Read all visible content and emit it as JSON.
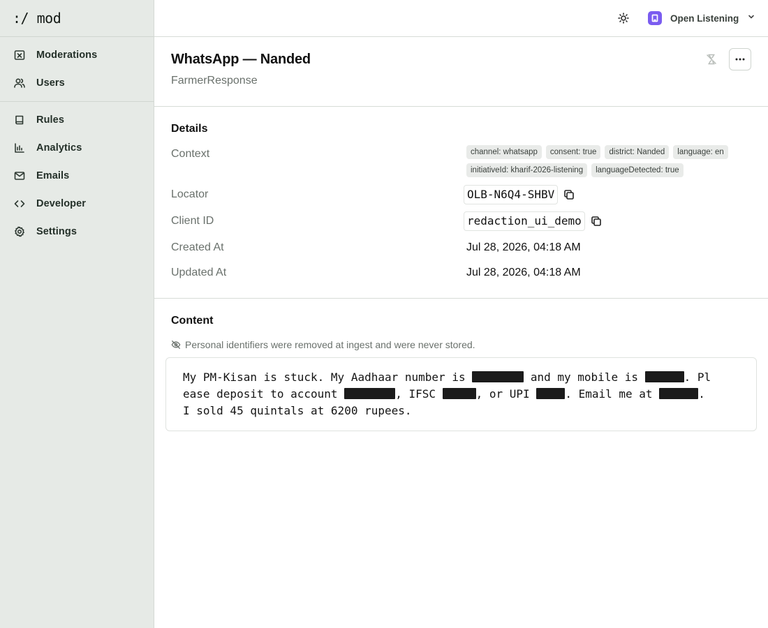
{
  "brand": ":/ mod",
  "sidebar": {
    "primary": [
      {
        "label": "Moderations",
        "icon": "moderation-icon"
      },
      {
        "label": "Users",
        "icon": "users-icon"
      }
    ],
    "secondary": [
      {
        "label": "Rules",
        "icon": "book-icon"
      },
      {
        "label": "Analytics",
        "icon": "chart-icon"
      },
      {
        "label": "Emails",
        "icon": "mail-icon"
      },
      {
        "label": "Developer",
        "icon": "code-icon"
      },
      {
        "label": "Settings",
        "icon": "gear-icon"
      }
    ]
  },
  "topbar": {
    "theme_icon": "sun-icon",
    "workspace_name": "Open Listening",
    "workspace_logo_color": "#7a5cf0"
  },
  "header": {
    "title": "WhatsApp — Nanded",
    "subtitle": "FarmerResponse"
  },
  "details": {
    "title": "Details",
    "context_label": "Context",
    "context_tags": [
      "channel: whatsapp",
      "consent: true",
      "district: Nanded",
      "language: en",
      "initiativeId: kharif-2026-listening",
      "languageDetected: true"
    ],
    "locator_label": "Locator",
    "locator_value": "OLB-N6Q4-SHBV",
    "client_id_label": "Client ID",
    "client_id_value": "redaction_ui_demo",
    "created_label": "Created At",
    "created_value": "Jul 28, 2026, 04:18 AM",
    "updated_label": "Updated At",
    "updated_value": "Jul 28, 2026, 04:18 AM"
  },
  "content": {
    "title": "Content",
    "pii_note": "Personal identifiers were removed at ingest and were never stored.",
    "segments": {
      "s1": "My PM-Kisan is stuck. My Aadhaar number is ",
      "s2": " and my mobile is ",
      "s3": ". Pl",
      "s4": "ease deposit to account ",
      "s5": ", IFSC ",
      "s6": ", or UPI ",
      "s7": ". Email me at ",
      "s8": ".",
      "s9": "I sold 45 quintals at 6200 rupees."
    }
  }
}
